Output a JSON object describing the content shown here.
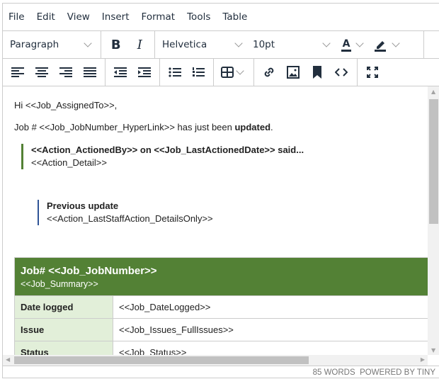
{
  "menu": [
    "File",
    "Edit",
    "View",
    "Insert",
    "Format",
    "Tools",
    "Table"
  ],
  "toolbar": {
    "block_format": "Paragraph",
    "bold": "B",
    "italic": "I",
    "font_family": "Helvetica",
    "font_size": "10pt",
    "text_color_glyph": "A"
  },
  "icons": [
    "align-left-icon",
    "align-center-icon",
    "align-right-icon",
    "align-justify-icon",
    "outdent-icon",
    "indent-icon",
    "bullet-list-icon",
    "numbered-list-icon",
    "table-icon",
    "link-icon",
    "image-icon",
    "bookmark-icon",
    "code-icon",
    "fullscreen-icon"
  ],
  "content": {
    "greeting": "Hi <<Job_AssignedTo>>,",
    "line2_prefix": "Job # <<Job_JobNumber_HyperLink>> has just been ",
    "line2_bold": "updated",
    "line2_suffix": ".",
    "quote1_title": "<<Action_ActionedBy>> on <<Job_LastActionedDate>> said...",
    "quote1_body": "<<Action_Detail>>",
    "quote2_title": "Previous update",
    "quote2_body": "<<Action_LastStaffAction_DetailsOnly>>",
    "table_title": "Job# <<Job_JobNumber>>",
    "table_subtitle": "<<Job_Summary>>",
    "rows": [
      {
        "label": "Date logged",
        "value": "<<Job_DateLogged>>"
      },
      {
        "label": "Issue",
        "value": "<<Job_Issues_FullIssues>>"
      },
      {
        "label": "Status",
        "value": "<<Job_Status>>"
      }
    ]
  },
  "status": {
    "words": "85 WORDS",
    "powered": "POWERED BY TINY"
  },
  "colors": {
    "accent_green": "#538135",
    "light_green": "#e2efd9",
    "quote_blue": "#2f5496"
  }
}
